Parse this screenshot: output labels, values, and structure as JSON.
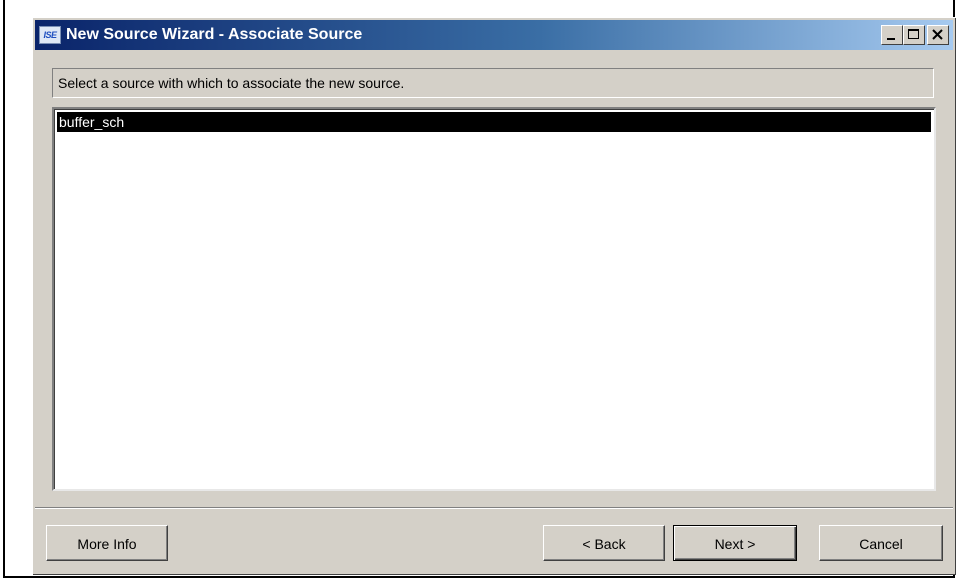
{
  "window": {
    "title": "New Source Wizard - Associate Source",
    "app_icon_label": "ISE"
  },
  "message": "Select a source with which to associate the new source.",
  "sources": [
    {
      "label": "buffer_sch",
      "selected": true
    }
  ],
  "buttons": {
    "more_info": "More Info",
    "back": "< Back",
    "next": "Next >",
    "cancel": "Cancel",
    "default": "next"
  },
  "colors": {
    "title_start": "#0a246a",
    "title_end": "#a6caf0",
    "face": "#d4d0c8",
    "selection": "#000000"
  },
  "icons": [
    "app-icon",
    "minimize-icon",
    "maximize-icon",
    "close-icon"
  ]
}
